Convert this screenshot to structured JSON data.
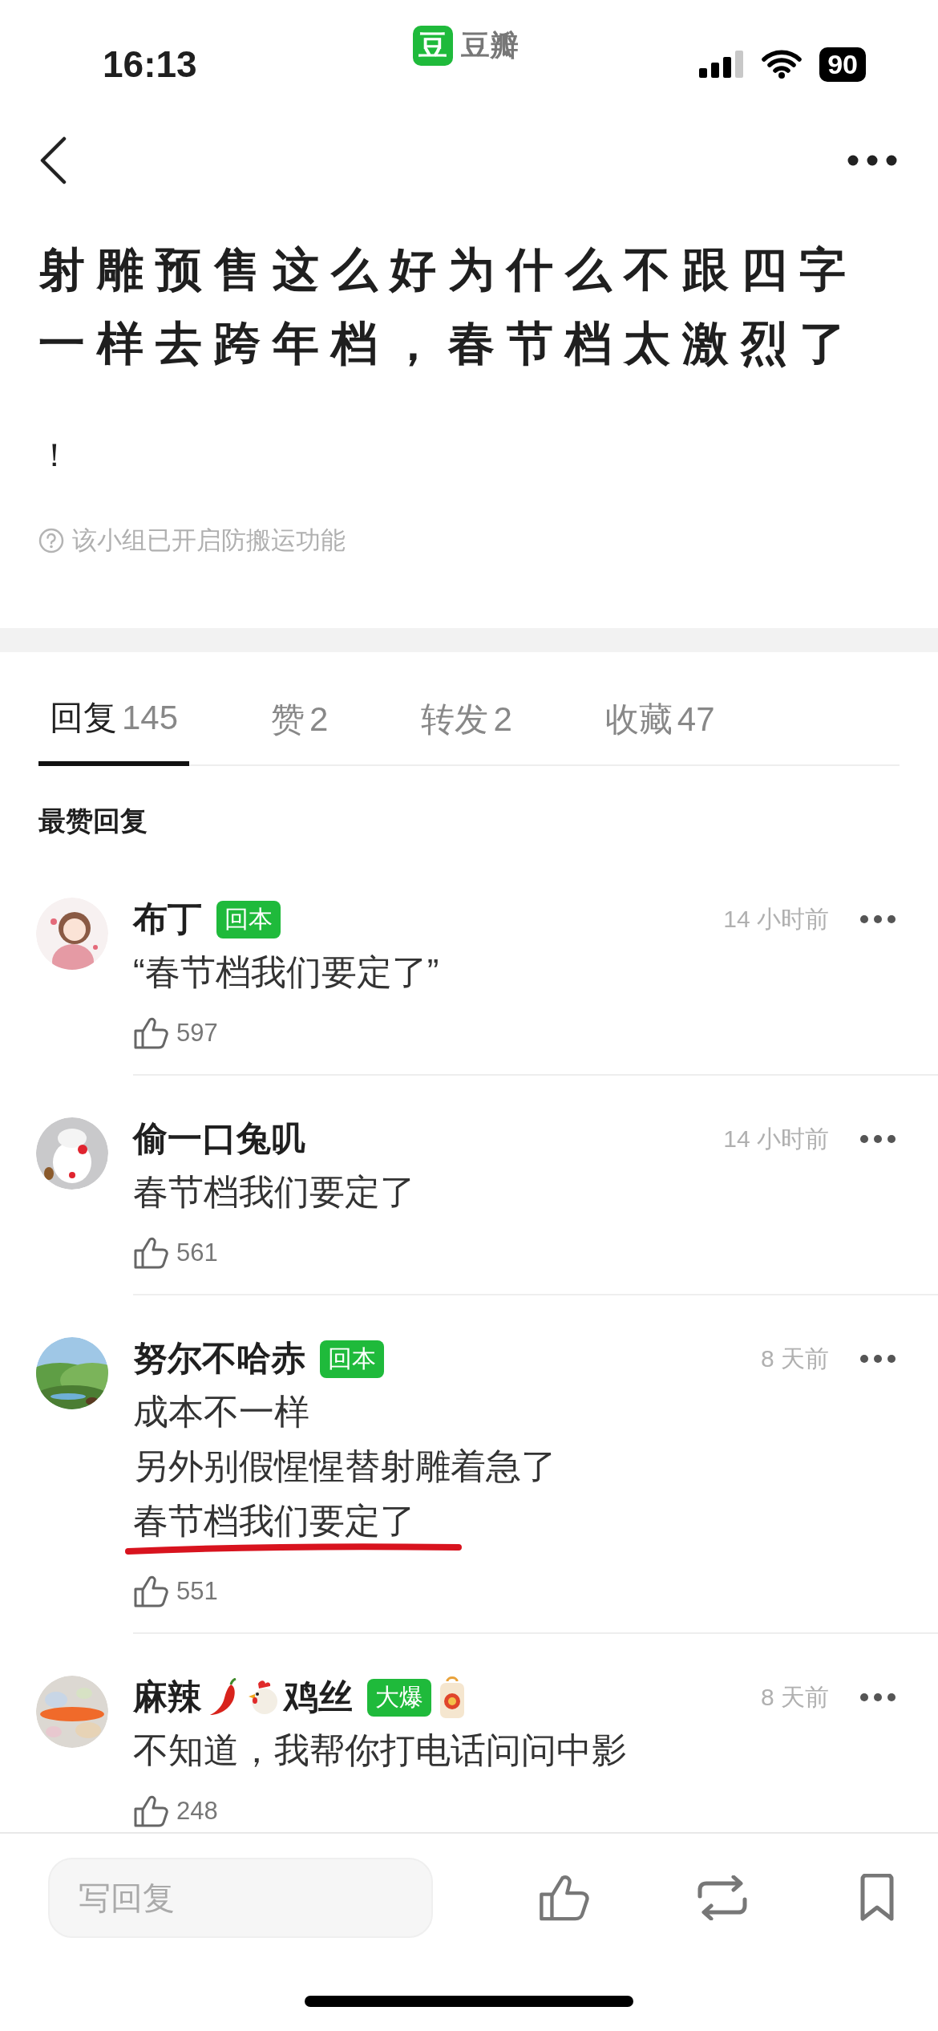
{
  "status_bar": {
    "time": "16:13",
    "app_badge": "豆",
    "app_name": "豆瓣",
    "battery": "90"
  },
  "post": {
    "title": "射雕预售这么好为什么不跟四字一样去跨年档，春节档太激烈了",
    "body": "！",
    "notice": "该小组已开启防搬运功能"
  },
  "tabs": [
    {
      "label": "回复",
      "count": "145",
      "selected": true
    },
    {
      "label": "赞",
      "count": "2",
      "selected": false
    },
    {
      "label": "转发",
      "count": "2",
      "selected": false
    },
    {
      "label": "收藏",
      "count": "47",
      "selected": false
    }
  ],
  "section_title": "最赞回复",
  "comments": [
    {
      "name": [
        {
          "kind": "text",
          "text": "布丁"
        }
      ],
      "badge": "回本",
      "charm": false,
      "time": "14 小时前",
      "lines": [
        "“春节档我们要定了”"
      ],
      "likes": "597",
      "underlined": false
    },
    {
      "name": [
        {
          "kind": "text",
          "text": "偷一口兔叽"
        }
      ],
      "charm": false,
      "time": "14 小时前",
      "lines": [
        "春节档我们要定了"
      ],
      "likes": "561",
      "underlined": false
    },
    {
      "name": [
        {
          "kind": "text",
          "text": "努尔不哈赤"
        }
      ],
      "badge": "回本",
      "charm": false,
      "time": "8 天前",
      "lines": [
        "成本不一样",
        "另外别假惺惺替射雕着急了",
        "春节档我们要定了"
      ],
      "likes": "551",
      "underlined": true
    },
    {
      "name": [
        {
          "kind": "text",
          "text": "麻辣"
        },
        {
          "kind": "chili"
        },
        {
          "kind": "chicken"
        },
        {
          "kind": "text",
          "text": "鸡丝"
        }
      ],
      "badge": "大爆",
      "charm": true,
      "time": "8 天前",
      "lines": [
        "不知道，我帮你打电话问问中影"
      ],
      "likes": "248",
      "underlined": false
    }
  ],
  "reply_bar": {
    "placeholder": "写回复"
  }
}
